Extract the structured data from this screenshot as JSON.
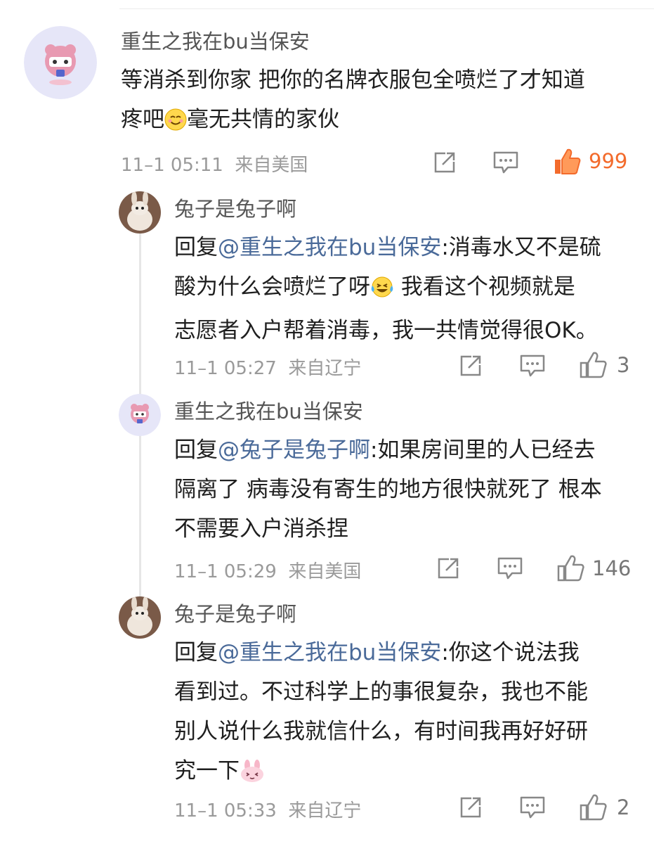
{
  "colors": {
    "mention": "#4a6a99",
    "like_hot": "#f36b2c",
    "meta": "#9a9a9a"
  },
  "main": {
    "username": "重生之我在bu当保安",
    "text_line1": "等消杀到你家 把你的名牌衣服包全喷烂了才知道",
    "text_line2a": "疼吧",
    "emoji": "smiling-face-emoji",
    "text_line2b": "毫无共情的家伙",
    "timestamp": "11–1 05:11",
    "location": "来自美国",
    "like_count": "999"
  },
  "replies": [
    {
      "username": "兔子是兔子啊",
      "reply_prefix": "回复",
      "mention": "@重生之我在bu当保安",
      "line1_rest": ":消毒水又不是硫",
      "line2a": "酸为什么会喷烂了呀",
      "emoji": "tears-of-joy-emoji",
      "line2b": " 我看这个视频就是",
      "line3": "志愿者入户帮着消毒，我一共情觉得很OK。",
      "timestamp": "11–1 05:27",
      "location": "来自辽宁",
      "like_count": "3"
    },
    {
      "username": "重生之我在bu当保安",
      "reply_prefix": "回复",
      "mention": "@兔子是兔子啊",
      "line1_rest": ":如果房间里的人已经去",
      "line2": "隔离了 病毒没有寄生的地方很快就死了 根本",
      "line3": "不需要入户消杀捏",
      "timestamp": "11–1 05:29",
      "location": "来自美国",
      "like_count": "146"
    },
    {
      "username": "兔子是兔子啊",
      "reply_prefix": "回复",
      "mention": "@重生之我在bu当保安",
      "line1_rest": ":你这个说法我",
      "line2": "看到过。不过科学上的事很复杂，我也不能",
      "line3": "别人说什么我就信什么，有时间我再好好研",
      "line4": "究一下",
      "emoji": "pink-bunny-emoji",
      "timestamp": "11–1 05:33",
      "location": "来自辽宁",
      "like_count": "2"
    }
  ]
}
